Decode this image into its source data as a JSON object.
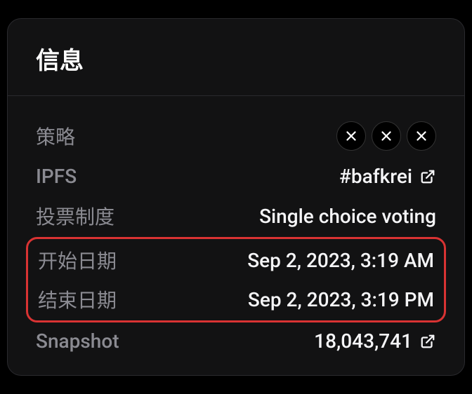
{
  "header": {
    "title": "信息"
  },
  "info": {
    "strategy_label": "策略",
    "ipfs_label": "IPFS",
    "ipfs_value": "#bafkrei",
    "voting_system_label": "投票制度",
    "voting_system_value": "Single choice voting",
    "start_date_label": "开始日期",
    "start_date_value": "Sep 2, 2023, 3:19 AM",
    "end_date_label": "结束日期",
    "end_date_value": "Sep 2, 2023, 3:19 PM",
    "snapshot_label": "Snapshot",
    "snapshot_value": "18,043,741"
  }
}
